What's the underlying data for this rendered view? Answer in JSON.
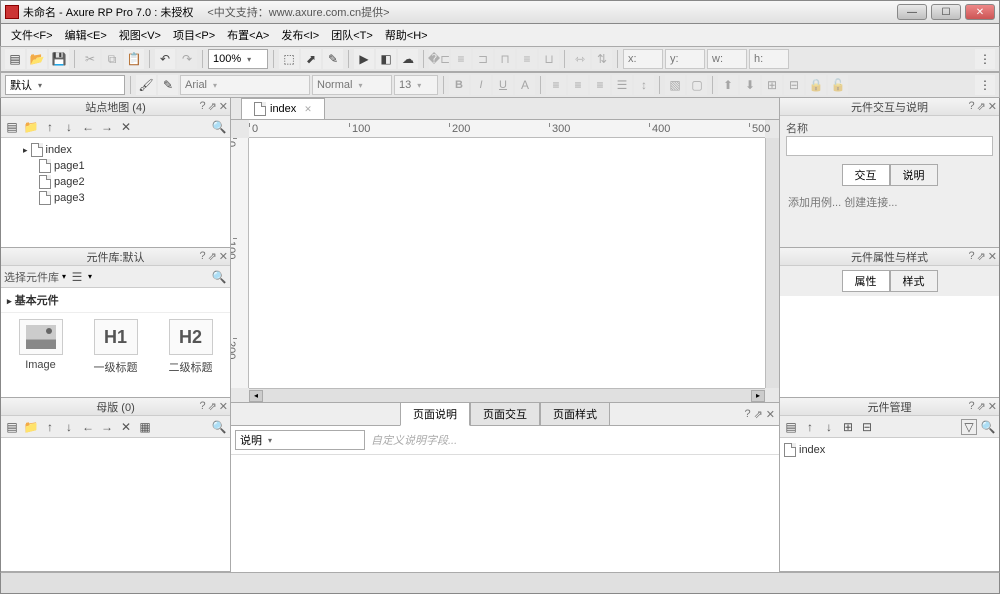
{
  "title": "未命名 - Axure RP Pro 7.0 : 未授权",
  "title_suffix": "<中文支持：www.axure.com.cn提供>",
  "menu": [
    "文件<F>",
    "编辑<E>",
    "视图<V>",
    "项目<P>",
    "布置<A>",
    "发布<I>",
    "团队<T>",
    "帮助<H>"
  ],
  "toolbar1": {
    "zoom": "100%"
  },
  "toolbar2": {
    "style_select": "默认",
    "font": "Arial",
    "weight": "Normal",
    "size": "13"
  },
  "sitemap": {
    "title": "站点地图 (4)",
    "root": "index",
    "pages": [
      "page1",
      "page2",
      "page3"
    ]
  },
  "widgets": {
    "title": "元件库:默认",
    "selector": "选择元件库",
    "section": "基本元件",
    "items": [
      {
        "label": "Image",
        "thumb": "img"
      },
      {
        "label": "一级标题",
        "thumb": "H1"
      },
      {
        "label": "二级标题",
        "thumb": "H2"
      }
    ]
  },
  "masters": {
    "title": "母版 (0)"
  },
  "canvas": {
    "tab": "index",
    "h_ticks": [
      "0",
      "100",
      "200",
      "300",
      "400",
      "500"
    ],
    "v_ticks": [
      "0",
      "100",
      "200"
    ]
  },
  "page_panel": {
    "tabs": [
      "页面说明",
      "页面交互",
      "页面样式"
    ],
    "note_label": "说明",
    "placeholder": "自定义说明字段..."
  },
  "interactions": {
    "title": "元件交互与说明",
    "name_label": "名称",
    "tabs": [
      "交互",
      "说明"
    ],
    "links": "添加用例... 创建连接..."
  },
  "properties": {
    "title": "元件属性与样式",
    "tabs": [
      "属性",
      "样式"
    ]
  },
  "outline": {
    "title": "元件管理",
    "item": "index"
  }
}
